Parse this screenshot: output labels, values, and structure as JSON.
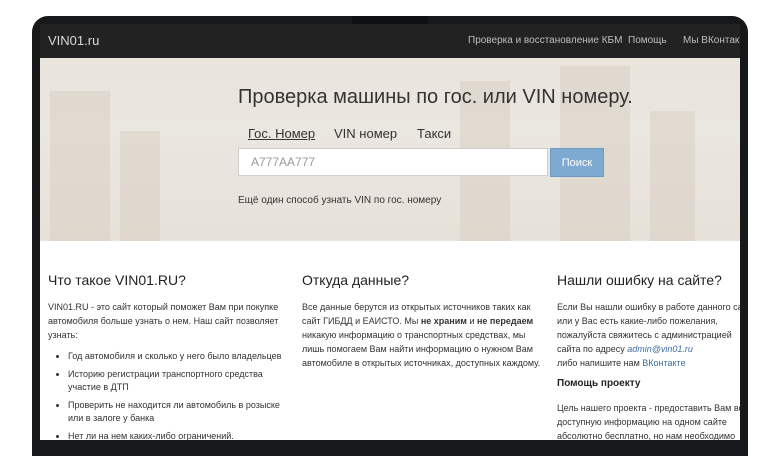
{
  "navbar": {
    "brand": "VIN01.ru",
    "links": [
      "Проверка и восстановление КБМ",
      "Помощь",
      "Мы ВКонтакте"
    ]
  },
  "hero": {
    "title": "Проверка машины по гос. или VIN номеру.",
    "tabs": [
      "Гос. Номер",
      "VIN номер",
      "Такси"
    ],
    "active_tab": "Гос. Номер",
    "search_placeholder": "А777АА777",
    "search_button": "Поиск",
    "alt_link": "Ещё один способ узнать VIN по гос. номеру"
  },
  "about": {
    "heading": "Что такое VIN01.RU?",
    "intro": "VIN01.RU - это сайт который поможет Вам при покупке автомобиля больше узнать о нем. Наш сайт позволяет узнать:",
    "items": [
      "Год автомобиля и сколько у него было владельцев",
      "Историю регистрации транспортного средства участие в ДТП",
      "Проверить не находится ли автомобиль в розыске или в залоге у банка",
      "Нет ли на нем каких-либо ограничений."
    ]
  },
  "sources": {
    "heading": "Откуда данные?",
    "text_1": "Все данные берутся из открытых источников таких как сайт ГИБДД и ЕАИСТО. Мы ",
    "bold_1": "не храним",
    "text_2": " и ",
    "bold_2": "не передаем",
    "text_3": " никакую информацию о транспортных средствах, мы лишь помогаем Вам найти информацию о нужном Вам автомобиле в открытых источниках, доступных каждому."
  },
  "errors": {
    "heading": "Нашли ошибку на сайте?",
    "text": "Если Вы нашли ошибку в работе данного сайта или у Вас есть какие-либо пожелания, пожалуйста свяжитесь с администрацией сайта по адресу",
    "email": "admin@vin01.ru",
    "vk_prefix": "либо напишите нам ",
    "vk_link": "ВКонтакте",
    "help_heading": "Помощь проекту",
    "help_text": "Цель нашего проекта - предоставить Вам всю доступную информацию на одном сайте абсолютно бесплатно, но нам необходимо держать"
  }
}
